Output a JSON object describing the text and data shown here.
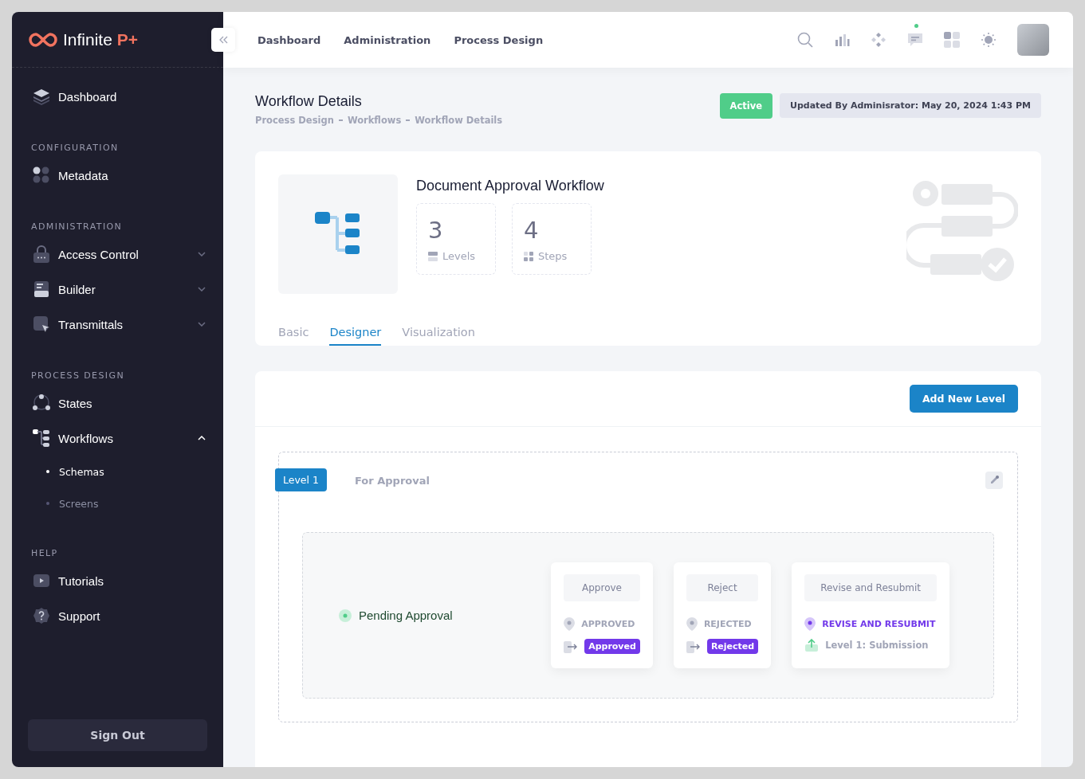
{
  "brand": {
    "name": "Infinite",
    "suffix": "P+"
  },
  "sidebar": {
    "sections": [
      {
        "items": [
          {
            "label": "Dashboard"
          }
        ]
      },
      {
        "heading": "CONFIGURATION",
        "items": [
          {
            "label": "Metadata"
          }
        ]
      },
      {
        "heading": "ADMINISTRATION",
        "items": [
          {
            "label": "Access Control",
            "expanded": false
          },
          {
            "label": "Builder",
            "expanded": false
          },
          {
            "label": "Transmittals",
            "expanded": false
          }
        ]
      },
      {
        "heading": "PROCESS DESIGN",
        "items": [
          {
            "label": "States"
          },
          {
            "label": "Workflows",
            "expanded": true,
            "children": [
              {
                "label": "Schemas",
                "selected": true
              },
              {
                "label": "Screens",
                "selected": false
              }
            ]
          }
        ]
      },
      {
        "heading": "HELP",
        "items": [
          {
            "label": "Tutorials"
          },
          {
            "label": "Support"
          }
        ]
      }
    ],
    "sign_out": "Sign Out"
  },
  "topbar": {
    "links": [
      "Dashboard",
      "Administration",
      "Process Design"
    ],
    "messages_unread": true
  },
  "header": {
    "title": "Workflow Details",
    "breadcrumbs": [
      "Process Design",
      "Workflows",
      "Workflow Details"
    ],
    "status": "Active",
    "updated": "Updated By Adminisrator: May 20, 2024 1:43 PM"
  },
  "workflow": {
    "name": "Document Approval Workflow",
    "stats": [
      {
        "value": "3",
        "label": "Levels"
      },
      {
        "value": "4",
        "label": "Steps"
      }
    ],
    "tabs": [
      {
        "label": "Basic",
        "selected": false
      },
      {
        "label": "Designer",
        "selected": true
      },
      {
        "label": "Visualization",
        "selected": false
      }
    ]
  },
  "designer": {
    "add_button": "Add New Level",
    "levels": [
      {
        "badge": "Level 1",
        "name": "For Approval",
        "state": "Pending Approval",
        "actions": [
          {
            "kind": "transition",
            "title": "Approve",
            "state": "APPROVED",
            "target": "Approved"
          },
          {
            "kind": "transition",
            "title": "Reject",
            "state": "REJECTED",
            "target": "Rejected"
          },
          {
            "kind": "return",
            "title": "Revise and Resubmit",
            "state": "REVISE AND RESUBMIT",
            "target": "Level 1: Submission"
          }
        ]
      }
    ]
  }
}
